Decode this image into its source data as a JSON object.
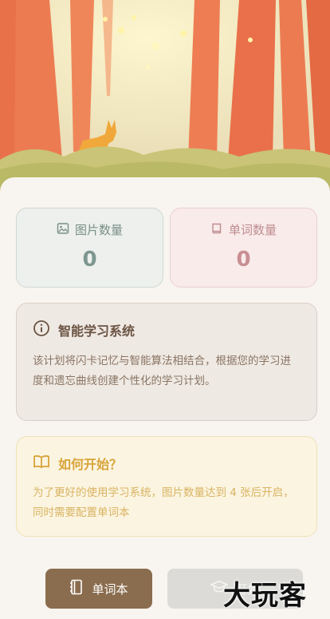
{
  "stats": {
    "images": {
      "label": "图片数量",
      "value": "0",
      "icon": "image-icon"
    },
    "words": {
      "label": "单词数量",
      "value": "0",
      "icon": "book-icon"
    }
  },
  "system_card": {
    "icon": "info-icon",
    "title": "智能学习系统",
    "body": "该计划将闪卡记忆与智能算法相结合，根据您的学习进度和遗忘曲线创建个性化的学习计划。"
  },
  "start_card": {
    "icon": "open-book-icon",
    "title": "如何开始？",
    "body": "为了更好的使用学习系统，图片数量达到 4 张后开启，同时需要配置单词本"
  },
  "buttons": {
    "vocab_label": "单词本",
    "start_label": "开始"
  },
  "watermark": "大玩客",
  "colors": {
    "accent_brown": "#8a6c4e",
    "stat_images": "#7d9690",
    "stat_words": "#c88e92",
    "start_yellow": "#d8a43a"
  }
}
